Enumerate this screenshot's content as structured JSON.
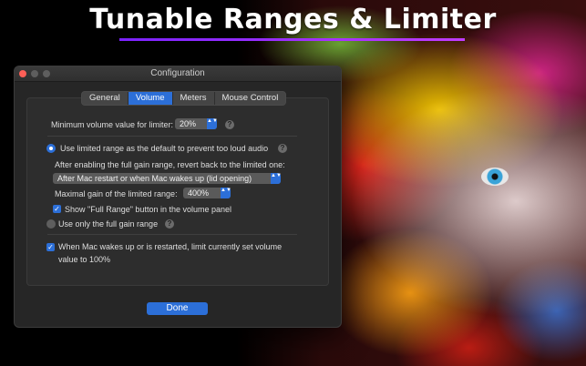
{
  "headline": "Tunable Ranges & Limiter",
  "window": {
    "title": "Configuration"
  },
  "tabs": [
    {
      "label": "General",
      "active": false
    },
    {
      "label": "Volume",
      "active": true
    },
    {
      "label": "Meters",
      "active": false
    },
    {
      "label": "Mouse Control",
      "active": false
    }
  ],
  "volume": {
    "min_limiter_label": "Minimum volume value for limiter:",
    "min_limiter_value": "20%",
    "limited_default_label": "Use limited range as the default to prevent too loud audio",
    "revert_label": "After enabling the full gain range, revert back to the limited one:",
    "revert_value": "After Mac restart or when Mac wakes up (lid opening)",
    "max_gain_label": "Maximal gain of the limited range:",
    "max_gain_value": "400%",
    "show_full_range_label": "Show \"Full Range\" button in the volume panel",
    "full_gain_only_label": "Use only the full gain range",
    "wake_limit_line1": "When Mac wakes up or is restarted, limit currently set volume",
    "wake_limit_line2": "value to 100%",
    "help_glyph": "?",
    "check_glyph": "✓",
    "arrows_glyph": "▲▼"
  },
  "done_label": "Done",
  "colors": {
    "accent": "#2c6fd8",
    "close": "#fe5f57",
    "underline": "#9a2cff"
  }
}
